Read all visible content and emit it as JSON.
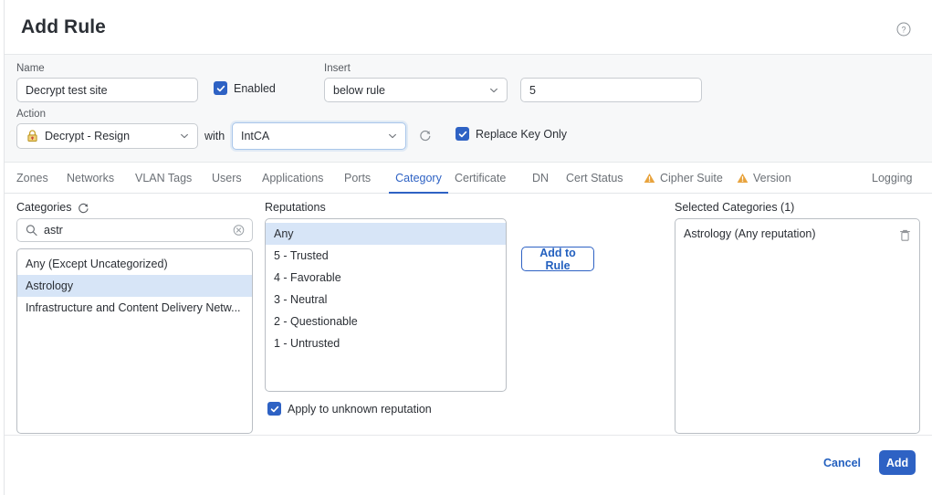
{
  "dialog": {
    "title": "Add Rule",
    "help_icon": "question-circle-icon"
  },
  "form": {
    "name_label": "Name",
    "name_value": "Decrypt test site",
    "enabled_label": "Enabled",
    "enabled_checked": true,
    "insert_label": "Insert",
    "insert_value": "below rule",
    "insert_position_value": "5",
    "action_label": "Action",
    "action_value": "Decrypt - Resign",
    "action_icon": "padlock-icon",
    "with_label": "with",
    "ca_value": "IntCA",
    "refresh_icon": "refresh-icon",
    "replace_key_label": "Replace Key Only",
    "replace_key_checked": true
  },
  "tabs": [
    {
      "label": "Zones",
      "active": false,
      "warning": false
    },
    {
      "label": "Networks",
      "active": false,
      "warning": false
    },
    {
      "label": "VLAN Tags",
      "active": false,
      "warning": false
    },
    {
      "label": "Users",
      "active": false,
      "warning": false
    },
    {
      "label": "Applications",
      "active": false,
      "warning": false
    },
    {
      "label": "Ports",
      "active": false,
      "warning": false
    },
    {
      "label": "Category",
      "active": true,
      "warning": false
    },
    {
      "label": "Certificate",
      "active": false,
      "warning": false
    },
    {
      "label": "DN",
      "active": false,
      "warning": false
    },
    {
      "label": "Cert Status",
      "active": false,
      "warning": false
    },
    {
      "label": "Cipher Suite",
      "active": false,
      "warning": true
    },
    {
      "label": "Version",
      "active": false,
      "warning": true
    },
    {
      "label": "Logging",
      "active": false,
      "warning": false
    }
  ],
  "categories_panel": {
    "title": "Categories",
    "refresh_icon": "refresh-icon",
    "search_value": "astr",
    "search_placeholder": "",
    "search_icon": "search-icon",
    "clear_icon": "clear-circle-icon",
    "items": [
      {
        "label": "Any (Except Uncategorized)",
        "selected": false
      },
      {
        "label": "Astrology",
        "selected": true
      },
      {
        "label": "Infrastructure and Content Delivery Netw...",
        "selected": false
      }
    ]
  },
  "reputations_panel": {
    "title": "Reputations",
    "items": [
      {
        "label": "Any",
        "selected": true
      },
      {
        "label": "5 - Trusted",
        "selected": false
      },
      {
        "label": "4 - Favorable",
        "selected": false
      },
      {
        "label": "3 - Neutral",
        "selected": false
      },
      {
        "label": "2 - Questionable",
        "selected": false
      },
      {
        "label": "1 - Untrusted",
        "selected": false
      }
    ],
    "unknown_label": "Apply to unknown reputation",
    "unknown_checked": true
  },
  "add_to_rule_label": "Add to Rule",
  "selected_panel": {
    "title": "Selected Categories (1)",
    "items": [
      {
        "label": "Astrology (Any reputation)",
        "delete_icon": "trash-icon"
      }
    ]
  },
  "footer": {
    "cancel_label": "Cancel",
    "add_label": "Add"
  },
  "colors": {
    "accent": "#2e62c4",
    "warning": "#e8a33d",
    "selection": "#d7e5f7",
    "band_bg": "#f7f8f9",
    "text": "#2b2f35",
    "muted": "#6b7076"
  }
}
